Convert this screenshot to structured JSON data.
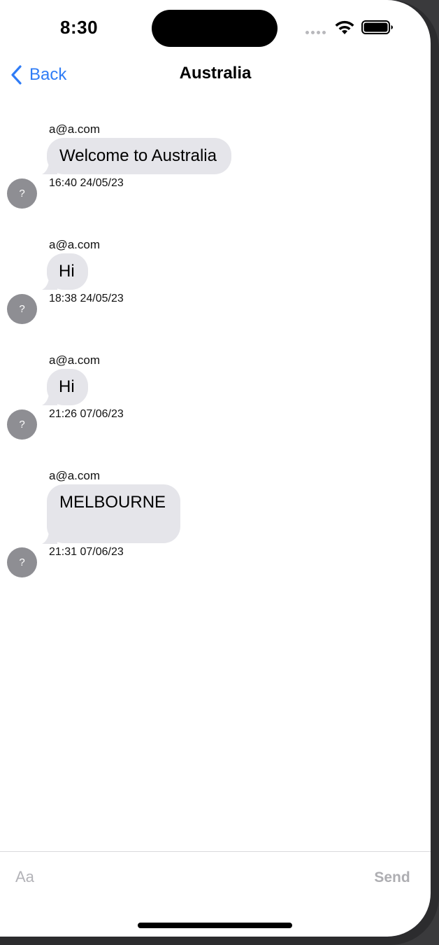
{
  "status_bar": {
    "time": "8:30"
  },
  "nav": {
    "back_label": "Back",
    "title": "Australia"
  },
  "messages": [
    {
      "sender": "a@a.com",
      "text": "Welcome to Australia",
      "timestamp": "16:40 24/05/23",
      "avatar": "?"
    },
    {
      "sender": "a@a.com",
      "text": "Hi",
      "timestamp": "18:38 24/05/23",
      "avatar": "?"
    },
    {
      "sender": "a@a.com",
      "text": "Hi",
      "timestamp": "21:26 07/06/23",
      "avatar": "?"
    },
    {
      "sender": "a@a.com",
      "text": "MELBOURNE",
      "timestamp": "21:31 07/06/23",
      "avatar": "?"
    }
  ],
  "composer": {
    "placeholder": "Aa",
    "value": "",
    "send_label": "Send"
  },
  "icons": {
    "back": "chevron-left-icon",
    "wifi": "wifi-icon",
    "battery": "battery-icon",
    "signal": "cellular-signal-icon"
  },
  "colors": {
    "accent": "#2f7cf6",
    "bubble": "#e5e5ea",
    "avatar": "#8e8e93",
    "send_disabled": "#aeaeb2"
  }
}
